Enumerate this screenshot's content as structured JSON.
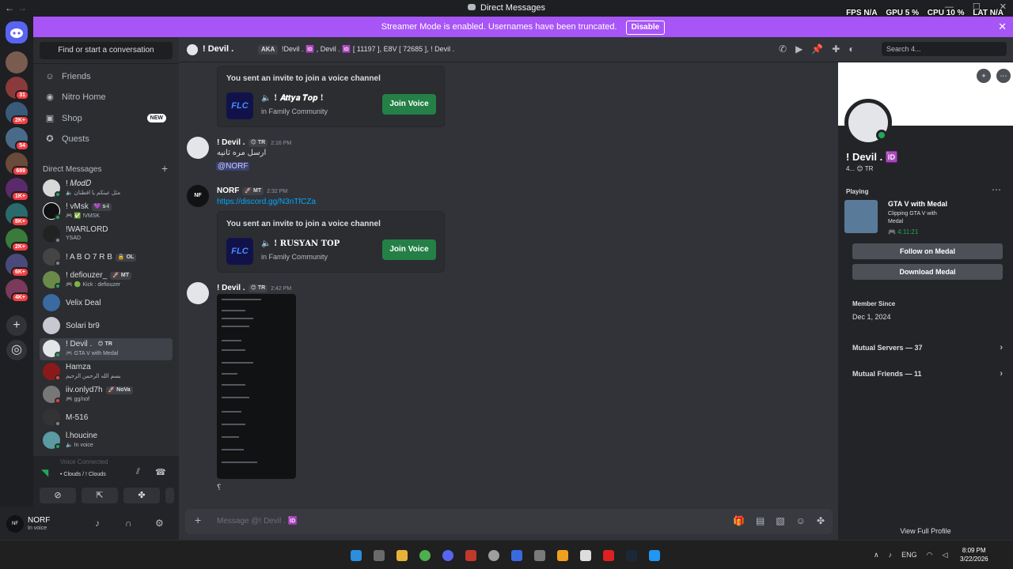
{
  "titlebar": {
    "title": "Direct Messages",
    "back": "←",
    "forward": "→"
  },
  "overlay": {
    "fps_label": "FPS",
    "fps": "N/A",
    "gpu_label": "GPU",
    "gpu": "5 %",
    "cpu_label": "CPU",
    "cpu": "10 %",
    "lat_label": "LAT",
    "lat": "N/A"
  },
  "rail": {
    "badges": [
      "31",
      "2K+",
      "54",
      "689",
      "1K+",
      "8K+",
      "2K+",
      "6K+",
      "4K+"
    ],
    "add_glyph": "+",
    "discover_glyph": "◎"
  },
  "banner": {
    "text": "Streamer Mode is enabled. Usernames have been truncated.",
    "button": "Disable",
    "close": "✕"
  },
  "sidebar": {
    "search_placeholder": "Find or start a conversation",
    "nav": [
      {
        "label": "Friends",
        "icon": "☺"
      },
      {
        "label": "Nitro Home",
        "icon": "◉"
      },
      {
        "label": "Shop",
        "icon": "▣",
        "badge": "NEW"
      },
      {
        "label": "Quests",
        "icon": "✪"
      }
    ],
    "dm_header": "Direct Messages",
    "dm_add": "+",
    "dms": [
      {
        "name": "! 𝑀𝑜𝑑𝐷",
        "sub": "🔈 مثل عينكم يا افطنان",
        "tag": ""
      },
      {
        "name": "! vMsk",
        "sub": "🎮 ✅ !VMSK",
        "tag": "💜 s-i"
      },
      {
        "name": "!WARLORD",
        "sub": "YSAD",
        "tag": ""
      },
      {
        "name": "! A B O 7 R B",
        "sub": "",
        "tag": "🔒 OL"
      },
      {
        "name": "! defiouzer_",
        "sub": "🎮 🟢 Kick : defiouzer",
        "tag": "🚀 MT"
      },
      {
        "name": "Velix Deal",
        "sub": "",
        "tag": ""
      },
      {
        "name": "Solari br9",
        "sub": "",
        "tag": ""
      },
      {
        "name": "! Devil .",
        "sub": "🎮 GTA V with Medal",
        "tag": "😊 TR"
      },
      {
        "name": "Hamza",
        "sub": "بسم الله الرحمن الرحيم",
        "tag": ""
      },
      {
        "name": "iiv.onlyd7h",
        "sub": "🎮 gg/nof",
        "tag": "🚀 NoVa"
      },
      {
        "name": "M-516",
        "sub": "",
        "tag": ""
      },
      {
        "name": "l.houcine",
        "sub": "🔈 In voice",
        "tag": ""
      }
    ]
  },
  "voice": {
    "connected_label": "Voice Connected",
    "channel": "• Clouds / ! Clouds",
    "buttons": [
      "camera-off",
      "screen-share",
      "activities",
      "soundboard"
    ]
  },
  "user": {
    "avatar_text": "NF",
    "name": "NORF",
    "status": "In voice"
  },
  "chat_header": {
    "name": "! Devil .",
    "aka_label": "AKA",
    "aka_names": "!Devil . 🆔 , Devil . 🆔 [ 11197 ], E8V [ 72685 ], ! Devil .",
    "search_placeholder": "Search 4..."
  },
  "messages": {
    "invite1": {
      "header": "You sent an invite to join a voice channel",
      "channel": "! 𝑨𝒕𝒕𝒚𝒂 𝑻𝒐𝒑 !",
      "guild": "in Family Community",
      "join": "Join Voice",
      "logo": "FLC"
    },
    "m1": {
      "author": "! Devil .",
      "tag": "😊 TR",
      "time": "2:16 PM",
      "text": "ارسل مره ثانيه",
      "mention": "@NORF"
    },
    "m2": {
      "author": "NORF",
      "tag": "🚀 MT",
      "time": "2:32 PM",
      "link": "https://discord.gg/N3nTfCZa",
      "avatar_text": "NF"
    },
    "invite2": {
      "header": "You sent an invite to join a voice channel",
      "channel": "! 𝐑𝐔𝐒𝐘𝐀𝐍 𝐓𝐎𝐏",
      "guild": "in Family Community",
      "join": "Join Voice",
      "logo": "FLC"
    },
    "m3": {
      "author": "! Devil .",
      "tag": "😊 TR",
      "time": "2:42 PM",
      "text": "؟"
    }
  },
  "composer": {
    "plus": "+",
    "placeholder": "Message @! Devil . 🆔"
  },
  "profile": {
    "name": "! Devil . 🆔",
    "sub": "4... 😊 TR",
    "playing_label": "Playing",
    "game": "GTA V with Medal",
    "game_detail": "Clipping GTA V with Medal",
    "game_time": "🎮 4:11:21",
    "follow": "Follow on Medal",
    "download": "Download Medal",
    "member_since_label": "Member Since",
    "member_since": "Dec 1, 2024",
    "mutual_servers": "Mutual Servers — 37",
    "mutual_friends": "Mutual Friends — 11",
    "view_full": "View Full Profile"
  },
  "taskbar": {
    "lang": "ENG",
    "time": "8:09 PM",
    "date": "3/22/2026"
  }
}
